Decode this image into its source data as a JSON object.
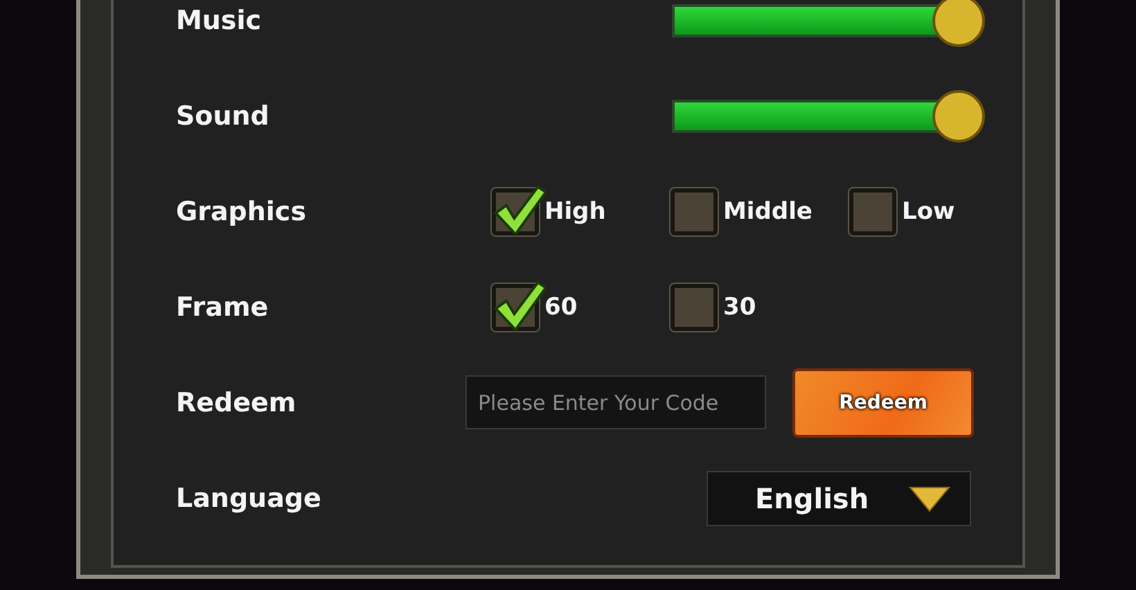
{
  "settings": [
    {
      "kind": "slider",
      "label": "Music",
      "level": 1
    },
    {
      "kind": "slider",
      "label": "Sound",
      "level": 1
    },
    {
      "kind": "options",
      "label": "Graphics",
      "options": [
        {
          "label": "High",
          "checked": true
        },
        {
          "label": "Middle",
          "checked": false
        },
        {
          "label": "Low",
          "checked": false
        }
      ]
    },
    {
      "kind": "options",
      "label": "Frame",
      "options": [
        {
          "label": "60",
          "checked": true
        },
        {
          "label": "30",
          "checked": false
        }
      ]
    },
    {
      "kind": "redeem",
      "label": "Redeem",
      "placeholder": "Please Enter Your Code",
      "button": "Redeem"
    },
    {
      "kind": "dropdown",
      "label": "Language",
      "value": "English"
    }
  ]
}
